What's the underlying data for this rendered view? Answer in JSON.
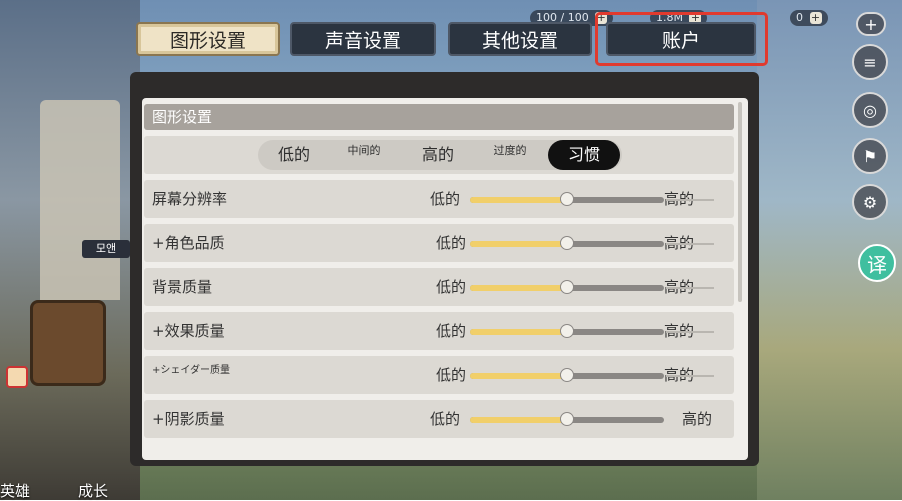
{
  "tabs": [
    {
      "label": "图形设置",
      "active": true
    },
    {
      "label": "声音设置",
      "active": false
    },
    {
      "label": "其他设置",
      "active": false
    },
    {
      "label": "账户",
      "active": false
    }
  ],
  "resources": {
    "energy": "100 / 100",
    "gold": "1.8M",
    "gems": "0",
    "plus": "+"
  },
  "panel": {
    "section_title": "图形设置",
    "presets": [
      {
        "label": "低的",
        "selected": false
      },
      {
        "label": "中间的",
        "selected": false
      },
      {
        "label": "高的",
        "selected": false
      },
      {
        "label": "过度的",
        "selected": false
      },
      {
        "label": "习惯",
        "selected": true
      }
    ],
    "settings": [
      {
        "label": "屏幕分辨率",
        "low": "低的",
        "high": "高的",
        "level": 0.5
      },
      {
        "label": "+角色品质",
        "low": "低的",
        "high": "高的",
        "level": 0.5
      },
      {
        "label": "背景质量",
        "low": "低的",
        "high": "高的",
        "level": 0.5
      },
      {
        "label": "+效果质量",
        "low": "低的",
        "high": "高的",
        "level": 0.5
      },
      {
        "label": "+シェイダー质量",
        "low": "低的",
        "high": "高的",
        "level": 0.5
      },
      {
        "label": "+阴影质量",
        "low": "低的",
        "high": "高的",
        "level": 0.5
      }
    ]
  },
  "side": {
    "translate_label": "译",
    "tag_label": "모앤"
  },
  "bottom": {
    "hero_label": "英雄",
    "growth_label": "成长"
  },
  "colors": {
    "accent_red": "#e03a2e",
    "slider_fill": "#f1cf6a",
    "translate_green": "#3fbf9f"
  }
}
